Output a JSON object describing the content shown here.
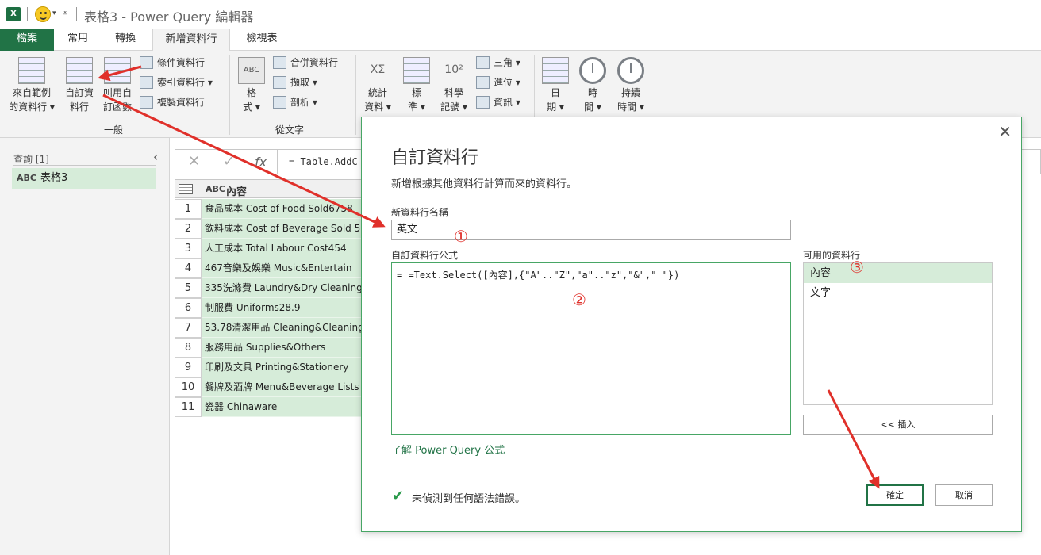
{
  "titlebar": {
    "app_icon": "X",
    "title": "表格3 - Power Query 編輯器"
  },
  "tabs": [
    "檔案",
    "常用",
    "轉換",
    "新增資料行",
    "檢視表"
  ],
  "ribbon": {
    "example_l1": "來自範例",
    "example_l2": "的資料行 ▾",
    "custom_l1": "自訂資",
    "custom_l2": "料行",
    "invoke_l1": "叫用自",
    "invoke_l2": "訂函數",
    "conditional": "條件資料行",
    "index": "索引資料行 ▾",
    "duplicate": "複製資料行",
    "general_group": "一般",
    "format_l1": "格",
    "format_l2": "式 ▾",
    "merge": "合併資料行",
    "extract": "擷取 ▾",
    "parse": "剖析 ▾",
    "text_group": "從文字",
    "stats_l1": "統計",
    "stats_l2": "資料 ▾",
    "standard_l1": "標",
    "standard_l2": "準 ▾",
    "sci_l1": "科學",
    "sci_l2": "記號 ▾",
    "trig": "三角 ▾",
    "round": "進位 ▾",
    "info": "資訊 ▾",
    "date_l1": "日",
    "date_l2": "期 ▾",
    "time_l1": "時",
    "time_l2": "間 ▾",
    "dur_l1": "持續",
    "dur_l2": "時間 ▾",
    "abc_icon": "ABC",
    "sci_icon": "10²",
    "stats_icon": "XΣ"
  },
  "queries": {
    "header": "查詢 [1]",
    "item": "表格3",
    "type_icon": "ABC"
  },
  "formula_bar": {
    "text": "= Table.AddC",
    "fx": "fx",
    "cancel": "✕",
    "confirm": "✓"
  },
  "table": {
    "column": "內容",
    "rows": [
      {
        "n": "1",
        "v": "食品成本 Cost of Food Sold6758"
      },
      {
        "n": "2",
        "v": "飲料成本 Cost of Beverage Sold 5"
      },
      {
        "n": "3",
        "v": "人工成本 Total Labour Cost454"
      },
      {
        "n": "4",
        "v": "467音樂及娛樂 Music&Entertain"
      },
      {
        "n": "5",
        "v": "335洗滌費 Laundry&Dry Cleaning"
      },
      {
        "n": "6",
        "v": "制服費 Uniforms28.9"
      },
      {
        "n": "7",
        "v": "53.78清潔用品 Cleaning&Cleaning"
      },
      {
        "n": "8",
        "v": "服務用品 Supplies&Others"
      },
      {
        "n": "9",
        "v": "印刷及文具 Printing&Stationery"
      },
      {
        "n": "10",
        "v": "餐牌及酒牌 Menu&Beverage Lists"
      },
      {
        "n": "11",
        "v": "瓷器 Chinaware"
      }
    ]
  },
  "dialog": {
    "title": "自訂資料行",
    "description": "新增根據其他資料行計算而來的資料行。",
    "name_label": "新資料行名稱",
    "name_value": "英文",
    "formula_label": "自訂資料行公式",
    "formula_value": "= =Text.Select([內容],{\"A\"..\"Z\",\"a\"..\"z\",\"&\",\" \"})",
    "available_label": "可用的資料行",
    "columns": [
      "內容",
      "文字"
    ],
    "insert_button": "<< 插入",
    "learn_link": "了解 Power Query 公式",
    "status": "未偵測到任何語法錯誤。",
    "ok_button": "確定",
    "cancel_button": "取消",
    "close": "✕"
  },
  "annotations": {
    "c1": "①",
    "c2": "②",
    "c3": "③"
  },
  "colors": {
    "accent": "#217346",
    "arrow": "#e0302a",
    "selection": "#d6ecd9"
  }
}
